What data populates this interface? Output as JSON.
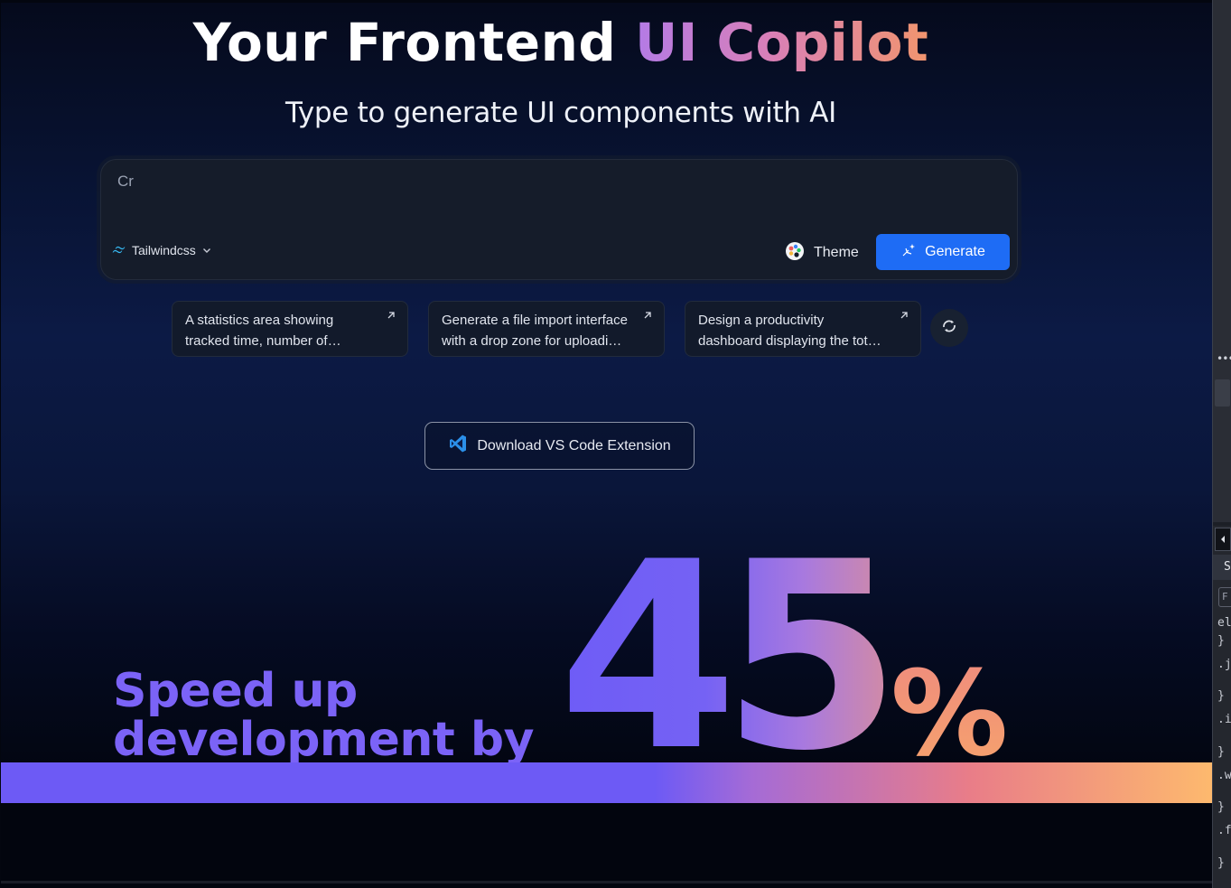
{
  "hero": {
    "title_plain": "Your Frontend ",
    "title_highlight": "UI Copilot",
    "subtitle": "Type to generate UI components with AI"
  },
  "prompt": {
    "value": "Cr",
    "framework": "Tailwindcss",
    "theme_label": "Theme",
    "generate_label": "Generate"
  },
  "suggestions": [
    {
      "text": "A statistics area showing tracked time, number of completed tasks and focus hours"
    },
    {
      "text": "Generate a file import interface with a drop zone for uploading documents"
    },
    {
      "text": "Design a productivity dashboard displaying the total hours tracked this week"
    }
  ],
  "vscode": {
    "label": "Download VS Code Extension"
  },
  "promo": {
    "line1": "Speed up",
    "line2": "development by",
    "number": "45",
    "unit": "%",
    "progress_percent": 45
  },
  "devtools": {
    "tab": "S",
    "filter": "F",
    "lines": [
      "el",
      "}",
      ".j",
      "}",
      ".i",
      "}",
      ".w",
      "}",
      ".f",
      "}"
    ]
  },
  "colors": {
    "accent_blue": "#1e6cf5",
    "purple": "#6d5af5",
    "orange": "#fdb96e"
  }
}
